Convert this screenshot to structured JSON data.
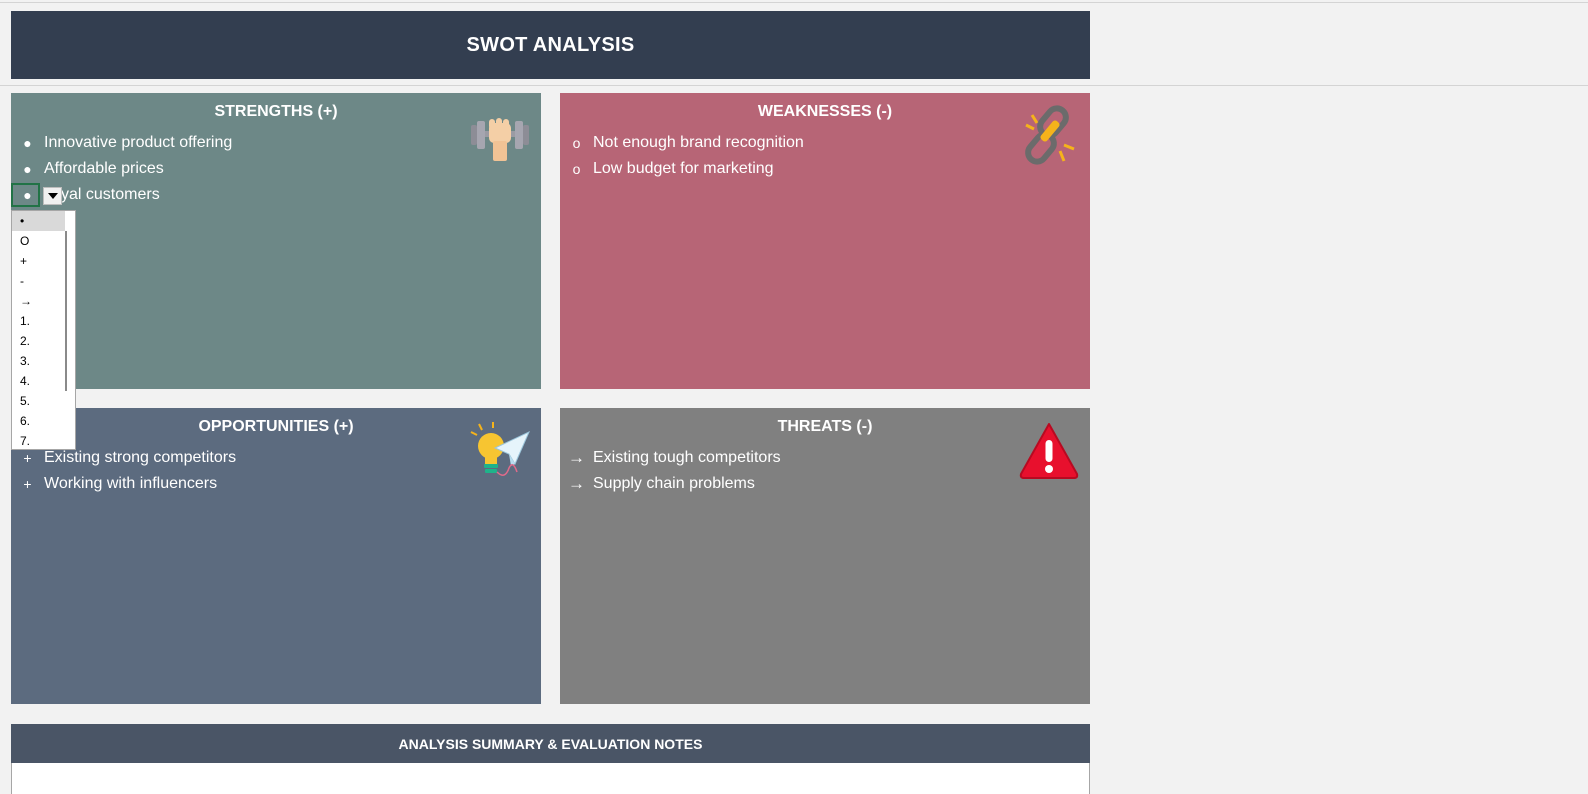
{
  "title": "SWOT ANALYSIS",
  "quadrants": {
    "strengths": {
      "heading": "STRENGTHS (+)",
      "icon": "dumbbell-fist-icon",
      "color": "#6d8887",
      "items": [
        {
          "marker": "●",
          "text": "Innovative product offering"
        },
        {
          "marker": "●",
          "text": "Affordable prices"
        },
        {
          "marker": "●",
          "text": "yal customers"
        }
      ]
    },
    "weaknesses": {
      "heading": "WEAKNESSES (-)",
      "icon": "broken-chain-icon",
      "color": "#b76576",
      "items": [
        {
          "marker": "o",
          "text": "Not enough brand recognition"
        },
        {
          "marker": "o",
          "text": "Low budget for marketing"
        }
      ]
    },
    "opportunities": {
      "heading": "OPPORTUNITIES (+)",
      "icon": "lightbulb-paper-plane-icon",
      "color": "#5c6b7f",
      "items": [
        {
          "marker": "+",
          "text": "Existing strong competitors"
        },
        {
          "marker": "+",
          "text": "Working with influencers"
        }
      ]
    },
    "threats": {
      "heading": "THREATS (-)",
      "icon": "warning-triangle-icon",
      "color": "#808080",
      "items": [
        {
          "marker": "→",
          "text": "Existing tough competitors"
        },
        {
          "marker": "→",
          "text": "Supply chain problems"
        }
      ]
    }
  },
  "dropdown": {
    "icon": "dropdown-arrow-icon",
    "options": [
      "•",
      "O",
      "+",
      "-",
      "→",
      "1.",
      "2.",
      "3.",
      "4.",
      "5.",
      "6.",
      "7."
    ],
    "selected_index": 0
  },
  "summary": {
    "heading": "ANALYSIS SUMMARY & EVALUATION NOTES"
  }
}
